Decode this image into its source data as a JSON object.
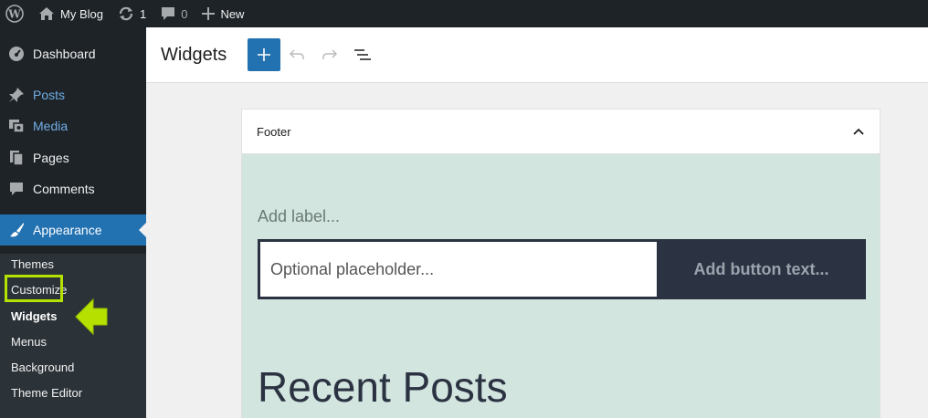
{
  "admin_bar": {
    "site_name": "My Blog",
    "updates_count": "1",
    "comments_count": "0",
    "new_label": "New"
  },
  "sidebar": {
    "items": [
      {
        "label": "Dashboard",
        "icon": "dashboard-icon"
      },
      {
        "label": "Posts",
        "icon": "pin-icon"
      },
      {
        "label": "Media",
        "icon": "media-icon"
      },
      {
        "label": "Pages",
        "icon": "pages-icon"
      },
      {
        "label": "Comments",
        "icon": "comments-icon"
      },
      {
        "label": "Appearance",
        "icon": "brush-icon"
      }
    ],
    "submenu": [
      "Themes",
      "Customize",
      "Widgets",
      "Menus",
      "Background",
      "Theme Editor"
    ]
  },
  "editor": {
    "title": "Widgets"
  },
  "widget_area": {
    "title": "Footer",
    "add_label": "Add label...",
    "search_placeholder": "Optional placeholder...",
    "button_text": "Add button text...",
    "recent_posts_heading": "Recent Posts"
  },
  "colors": {
    "accent": "#2271b1",
    "highlight": "#b6e000",
    "admin_bg": "#1d2327"
  }
}
